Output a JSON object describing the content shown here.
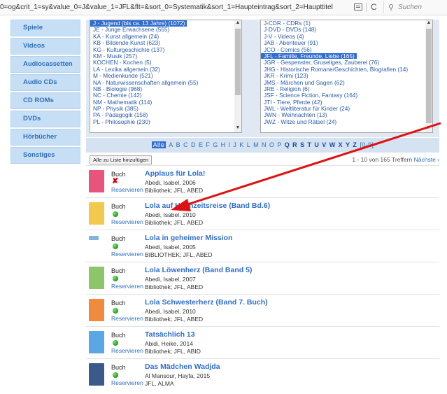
{
  "url": "0=og&crit_1=sy&value_0=J&value_1=JFL&flt=&sort_0=Systematik&sort_1=Haupteintrag&sort_2=Haupttitel",
  "search_placeholder": "Suchen",
  "sidebar": {
    "items": [
      "Spiele",
      "Videos",
      "Audiocassetten",
      "Audio CDs",
      "CD ROMs",
      "DVDs",
      "Hörbücher",
      "Sonstiges"
    ]
  },
  "left_list": [
    "J - Jugend (bis ca. 13 Jahre) (1072)",
    "JE - Junge Erwachsene (555)",
    "KA - Kunst allgemein (24)",
    "KB - Bildende Kunst (623)",
    "KG - Kulturgeschichte (137)",
    "KM - Musik (257)",
    "KOCHEN - Kochen (5)",
    "LA - Lexika allgemein (32)",
    "M - Medienkunde (521)",
    "NA - Naturwissenschaften allgemein (55)",
    "NB - Biologie (968)",
    "NC - Chemie (142)",
    "NM - Mathematik (114)",
    "NP - Physik (385)",
    "PA - Pädagogik (158)",
    "PL - Philosophie (230)"
  ],
  "right_list": [
    "J-CDR - CDRs (1)",
    "J-DVD - DVDs (148)",
    "J-V - Videos (4)",
    "JAB - Abenteuer (91)",
    "JCO - Comics (56)",
    "JFL - Familie, Freunde, Liebe (165)",
    "JGR - Gespenster, Gruseliges, Zauberei (76)",
    "JHG - Historische Romane/Geschichten, Biografien (14)",
    "JKR - Krimi (123)",
    "JMS - Märchen und Sagen (62)",
    "JRE - Religion (6)",
    "JSF - Science Fiction, Fantasy (164)",
    "JTI - Tiere, Pferde (42)",
    "JWL - Weltliteratur für Kinder (24)",
    "JWN - Weihnachten (13)",
    "JWZ - Witze und Rätsel (24)"
  ],
  "alphabet": {
    "all": "Alle",
    "letters": [
      "A",
      "B",
      "C",
      "D",
      "E",
      "F",
      "G",
      "H",
      "I",
      "J",
      "K",
      "L",
      "M",
      "N",
      "O",
      "P",
      "Q",
      "R",
      "S",
      "T",
      "U",
      "V",
      "W",
      "X",
      "Y",
      "Z",
      "[0-9]"
    ]
  },
  "toolbar": {
    "add_all": "Alle zu Liste hinzufügen",
    "hits": "1 - 10 von 165 Treffern",
    "next": "Nächste"
  },
  "results": [
    {
      "type": "Buch",
      "avail": "no",
      "reserve": "Reservieren",
      "title": "Applaus für Lola!",
      "author": "Abedi, Isabel, 2006",
      "holdings": "Bibliothek; JFL, ABED",
      "cover": "#e8547c"
    },
    {
      "type": "Buch",
      "avail": "yes",
      "reserve": "Reservieren",
      "title": "Lola auf Hochzeitsreise (Band Bd.6)",
      "author": "Abedi, Isabel, 2010",
      "holdings": "Bibliothek; JFL, ABED",
      "cover": "#f2c94c"
    },
    {
      "type": "Buch",
      "avail": "yes",
      "reserve": "Reservieren",
      "title": "Lola in geheimer Mission",
      "author": "Abedi, Isabel, 2005",
      "holdings": "BIBLIOTHEK; JFL, ABED",
      "cover": "#7fb3e0"
    },
    {
      "type": "Buch",
      "avail": "yes",
      "reserve": "Reservieren",
      "title": "Lola Löwenherz (Band Band 5)",
      "author": "Abedi, Isabel, 2007",
      "holdings": "Bibliothek; JFL, ABED",
      "cover": "#8cc56a"
    },
    {
      "type": "Buch",
      "avail": "yes",
      "reserve": "Reservieren",
      "title": "Lola Schwesterherz (Band 7. Buch)",
      "author": "Abedi, Isabel, 2010",
      "holdings": "Bibliothek; JFL, ABED",
      "cover": "#f08a3c"
    },
    {
      "type": "Buch",
      "avail": "yes",
      "reserve": "Reservieren",
      "title": "Tatsächlich 13",
      "author": "Abidi, Heike, 2014",
      "holdings": "Bibliothek; JFL, ABID",
      "cover": "#5aa7e6"
    },
    {
      "type": "Buch",
      "avail": "yes",
      "reserve": "Reservieren",
      "title": "Das Mädchen Wadjda",
      "author": "Al Mansour, Hayfa, 2015",
      "holdings": "JFL, ALMA",
      "cover": "#3b5a8c"
    }
  ],
  "colors": {
    "link": "#2f6dd0",
    "selected": "#2f6dd0",
    "arrow": "#e01010",
    "available": "#1a9a1a",
    "unavailable": "#d00000"
  }
}
